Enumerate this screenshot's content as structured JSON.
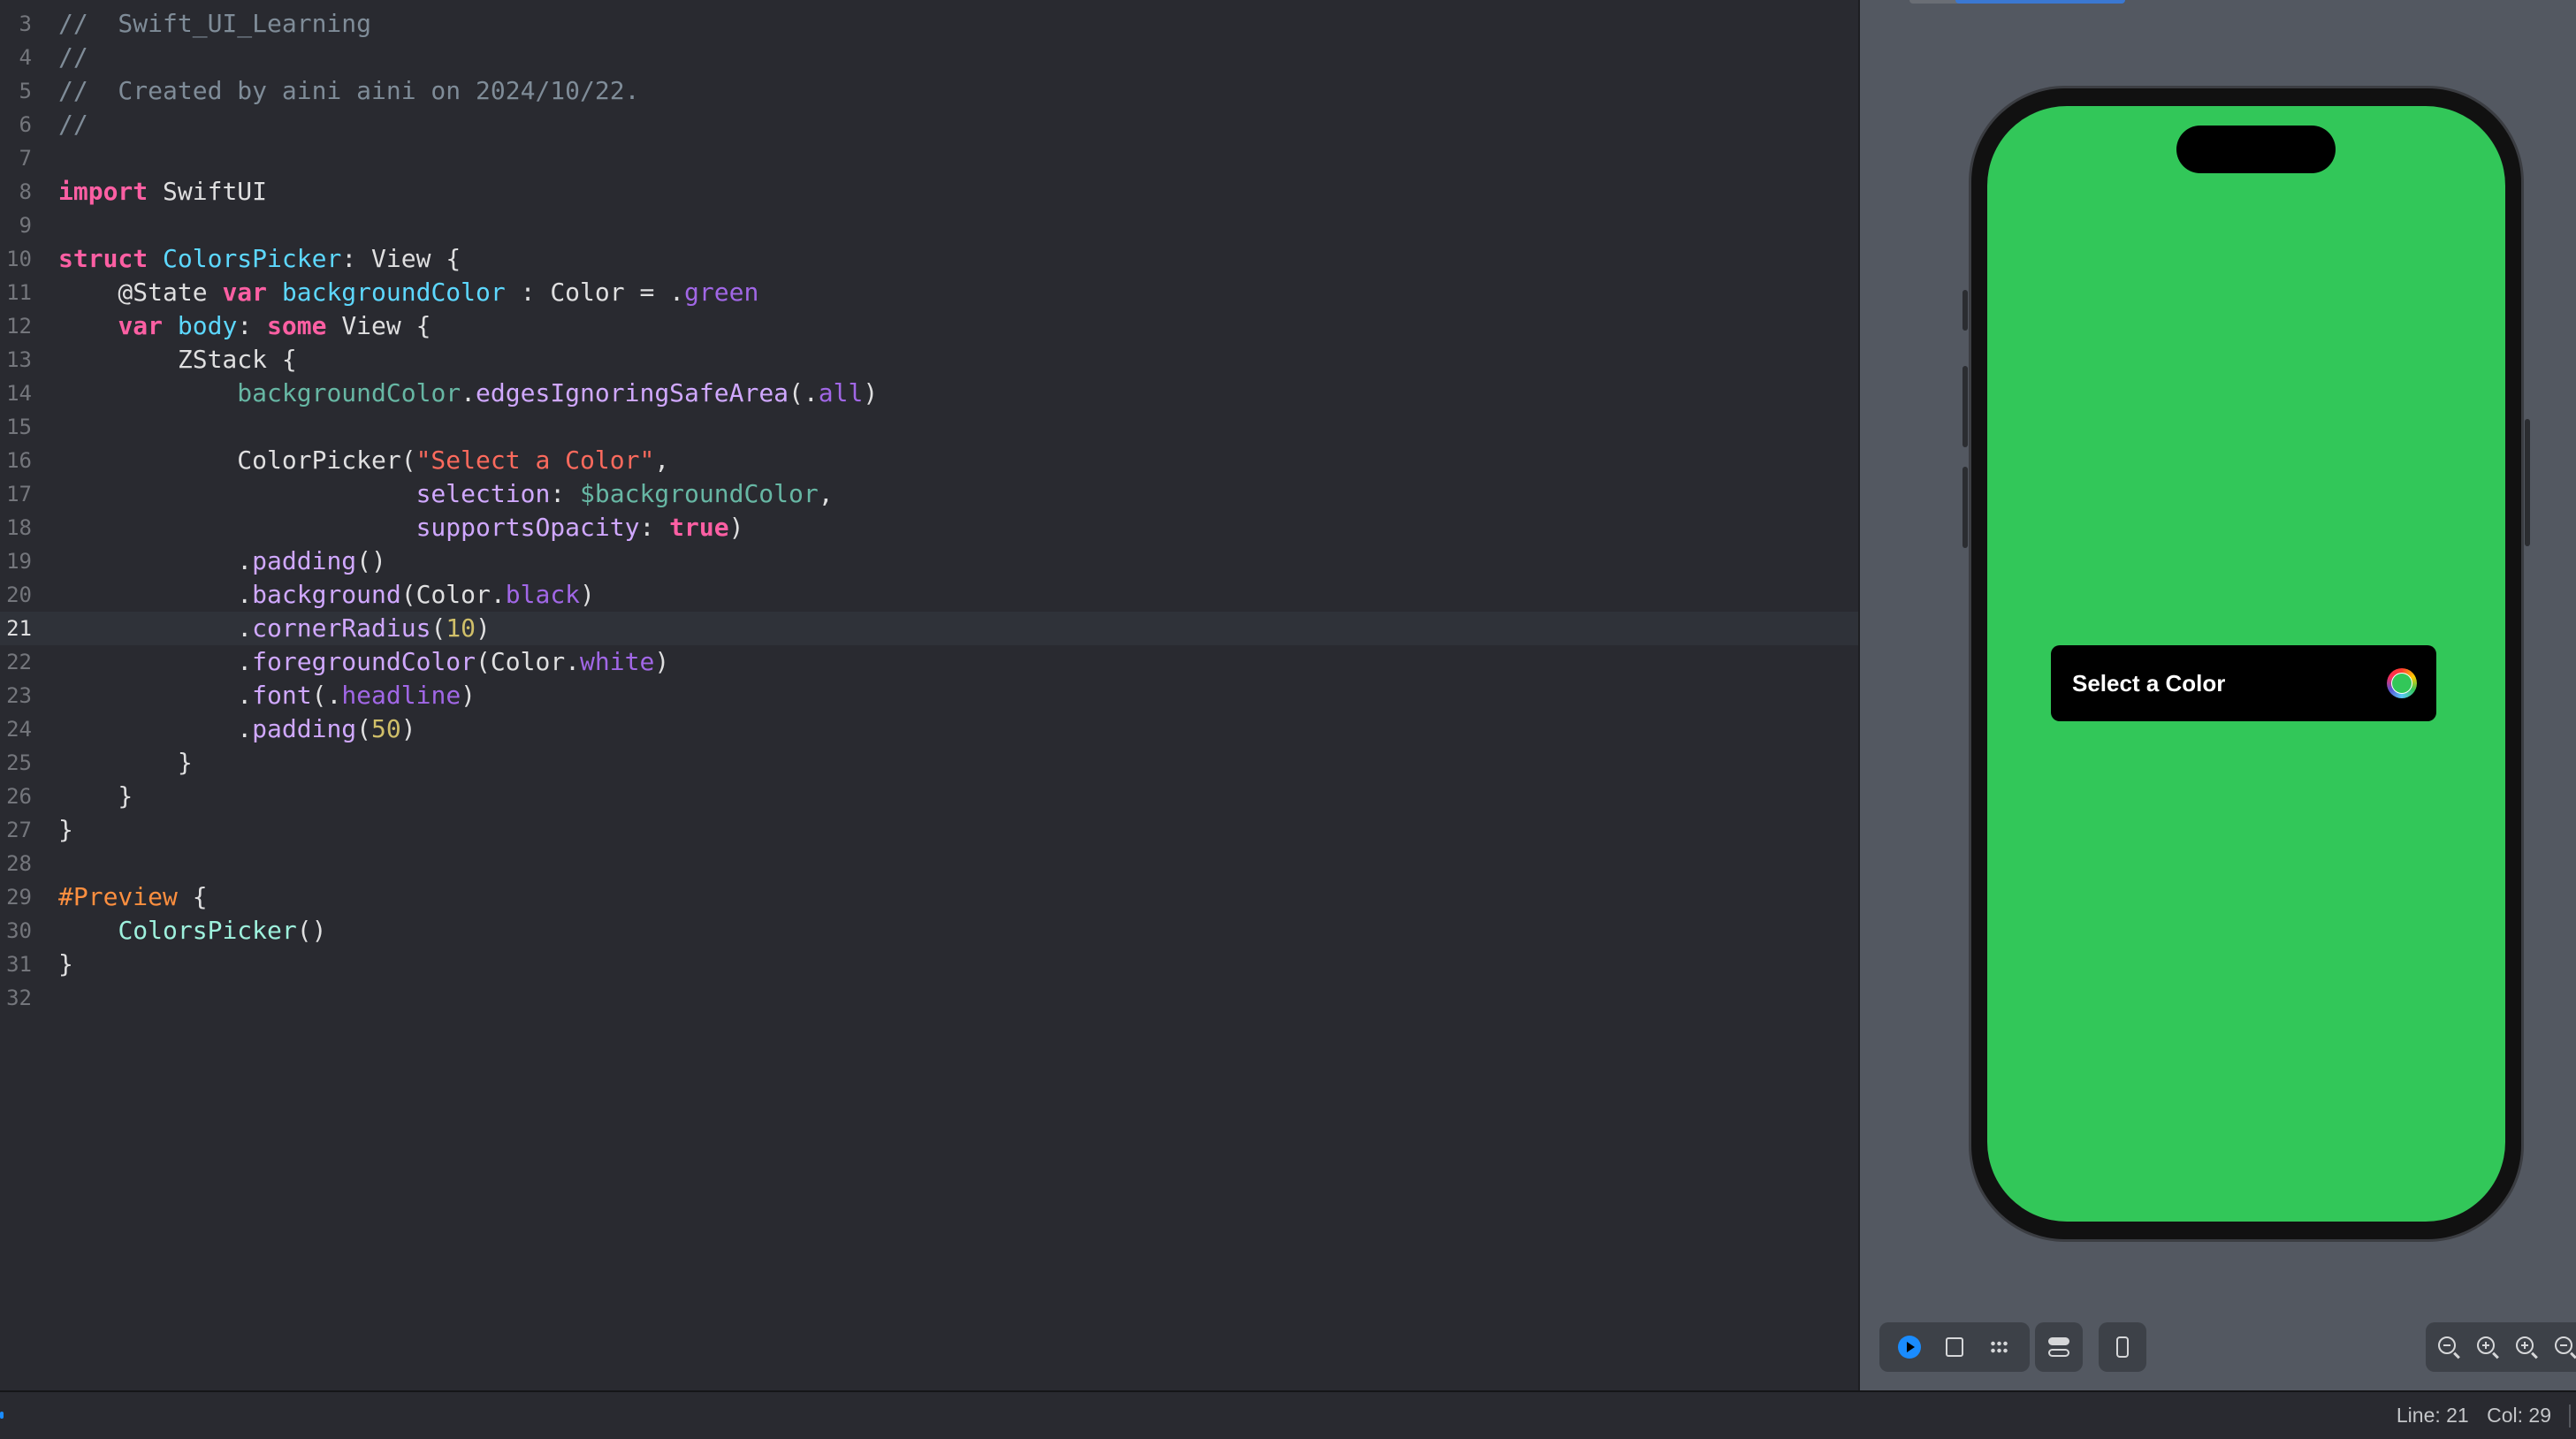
{
  "editor": {
    "current_line": 21,
    "lines": [
      {
        "n": "3",
        "t": [
          [
            "cmt",
            "//  Swift_UI_Learning"
          ]
        ]
      },
      {
        "n": "4",
        "t": [
          [
            "cmt",
            "//"
          ]
        ]
      },
      {
        "n": "5",
        "t": [
          [
            "cmt",
            "//  Created by aini aini on 2024/10/22."
          ]
        ]
      },
      {
        "n": "6",
        "t": [
          [
            "cmt",
            "//"
          ]
        ]
      },
      {
        "n": "7",
        "t": []
      },
      {
        "n": "8",
        "t": [
          [
            "kw",
            "import"
          ],
          [
            "",
            " SwiftUI"
          ]
        ]
      },
      {
        "n": "9",
        "t": []
      },
      {
        "n": "10",
        "t": [
          [
            "kw",
            "struct"
          ],
          [
            "",
            " "
          ],
          [
            "ty",
            "ColorsPicker"
          ],
          [
            "",
            ": View {"
          ]
        ]
      },
      {
        "n": "11",
        "t": [
          [
            "",
            "    @State "
          ],
          [
            "kw",
            "var"
          ],
          [
            "",
            " "
          ],
          [
            "ty",
            "backgroundColor"
          ],
          [
            "",
            " : Color = ."
          ],
          [
            "pr",
            "green"
          ]
        ]
      },
      {
        "n": "12",
        "t": [
          [
            "",
            "    "
          ],
          [
            "kw",
            "var"
          ],
          [
            "",
            " "
          ],
          [
            "ty",
            "body"
          ],
          [
            "",
            ": "
          ],
          [
            "kw",
            "some"
          ],
          [
            "",
            " View {"
          ]
        ]
      },
      {
        "n": "13",
        "t": [
          [
            "",
            "        ZStack {"
          ]
        ]
      },
      {
        "n": "14",
        "t": [
          [
            "",
            "            "
          ],
          [
            "fn",
            "backgroundColor"
          ],
          [
            "",
            "."
          ],
          [
            "ot",
            "edgesIgnoringSafeArea"
          ],
          [
            "",
            "(."
          ],
          [
            "pr",
            "all"
          ],
          [
            "",
            ")"
          ]
        ]
      },
      {
        "n": "15",
        "t": []
      },
      {
        "n": "16",
        "t": [
          [
            "",
            "            ColorPicker("
          ],
          [
            "str",
            "\"Select a Color\""
          ],
          [
            "",
            ","
          ]
        ]
      },
      {
        "n": "17",
        "t": [
          [
            "",
            "                        "
          ],
          [
            "ot",
            "selection"
          ],
          [
            "",
            ": "
          ],
          [
            "fn",
            "$backgroundColor"
          ],
          [
            "",
            ","
          ]
        ]
      },
      {
        "n": "18",
        "t": [
          [
            "",
            "                        "
          ],
          [
            "ot",
            "supportsOpacity"
          ],
          [
            "",
            ": "
          ],
          [
            "kw",
            "true"
          ],
          [
            "",
            ")"
          ]
        ]
      },
      {
        "n": "19",
        "t": [
          [
            "",
            "            ."
          ],
          [
            "ot",
            "padding"
          ],
          [
            "",
            "()"
          ]
        ]
      },
      {
        "n": "20",
        "t": [
          [
            "",
            "            ."
          ],
          [
            "ot",
            "background"
          ],
          [
            "",
            "(Color."
          ],
          [
            "pr",
            "black"
          ],
          [
            "",
            ")"
          ]
        ]
      },
      {
        "n": "21",
        "t": [
          [
            "",
            "            ."
          ],
          [
            "ot",
            "cornerRadius"
          ],
          [
            "",
            "("
          ],
          [
            "num",
            "10"
          ],
          [
            "",
            ")"
          ]
        ]
      },
      {
        "n": "22",
        "t": [
          [
            "",
            "            ."
          ],
          [
            "ot",
            "foregroundColor"
          ],
          [
            "",
            "(Color."
          ],
          [
            "pr",
            "white"
          ],
          [
            "",
            ")"
          ]
        ]
      },
      {
        "n": "23",
        "t": [
          [
            "",
            "            ."
          ],
          [
            "ot",
            "font"
          ],
          [
            "",
            "(."
          ],
          [
            "pr",
            "headline"
          ],
          [
            "",
            ")"
          ]
        ]
      },
      {
        "n": "24",
        "t": [
          [
            "",
            "            ."
          ],
          [
            "ot",
            "padding"
          ],
          [
            "",
            "("
          ],
          [
            "num",
            "50"
          ],
          [
            "",
            ")"
          ]
        ]
      },
      {
        "n": "25",
        "t": [
          [
            "",
            "        }"
          ]
        ]
      },
      {
        "n": "26",
        "t": [
          [
            "",
            "    }"
          ]
        ]
      },
      {
        "n": "27",
        "t": [
          [
            "",
            "}"
          ]
        ]
      },
      {
        "n": "28",
        "t": []
      },
      {
        "n": "29",
        "t": [
          [
            "pp",
            "#Preview"
          ],
          [
            "",
            " {"
          ]
        ]
      },
      {
        "n": "30",
        "t": [
          [
            "",
            "    "
          ],
          [
            "uf",
            "ColorsPicker"
          ],
          [
            "",
            "()"
          ]
        ]
      },
      {
        "n": "31",
        "t": [
          [
            "",
            "}"
          ]
        ]
      },
      {
        "n": "32",
        "t": []
      }
    ]
  },
  "preview": {
    "background_color": "#32c759",
    "picker_label": "Select a Color",
    "picker_selected_color": "#32c759"
  },
  "canvas_toolbar": {
    "left_group": [
      "live-mode-icon",
      "selectable-mode-icon",
      "variants-icon"
    ],
    "settings": "device-settings-icon",
    "device": "device-icon",
    "zoom_group": [
      "zoom-out-icon",
      "zoom-in-icon",
      "zoom-100-icon",
      "zoom-fit-icon"
    ]
  },
  "status": {
    "line_label": "Line: 21",
    "col_label": "Col: 29"
  }
}
